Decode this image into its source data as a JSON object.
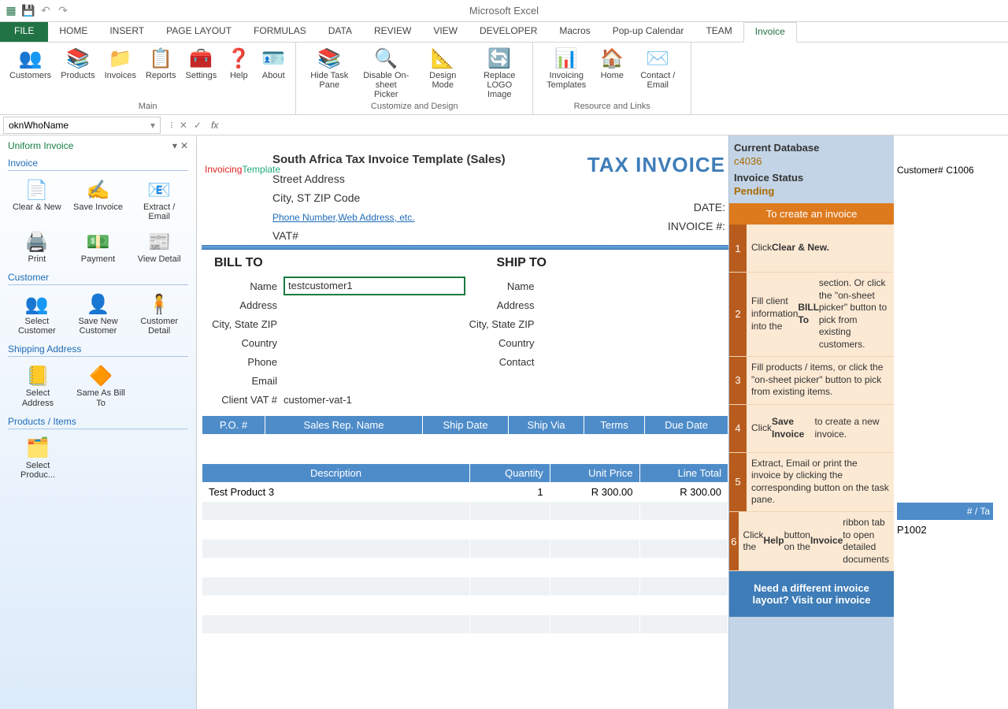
{
  "app_title": "Microsoft Excel",
  "tabs": [
    "FILE",
    "HOME",
    "INSERT",
    "PAGE LAYOUT",
    "FORMULAS",
    "DATA",
    "REVIEW",
    "VIEW",
    "DEVELOPER",
    "Macros",
    "Pop-up Calendar",
    "TEAM",
    "Invoice"
  ],
  "ribbon": {
    "main": {
      "label": "Main",
      "items": [
        "Customers",
        "Products",
        "Invoices",
        "Reports",
        "Settings",
        "Help",
        "About"
      ]
    },
    "design": {
      "label": "Customize and Design",
      "items": [
        "Hide Task Pane",
        "Disable On-sheet Picker",
        "Design Mode",
        "Replace LOGO Image"
      ]
    },
    "resource": {
      "label": "Resource and Links",
      "items": [
        "Invoicing Templates",
        "Home",
        "Contact / Email"
      ]
    }
  },
  "name_box": "oknWhoName",
  "task_pane": {
    "title": "Uniform Invoice",
    "sections": {
      "invoice": {
        "label": "Invoice",
        "items": [
          "Clear & New",
          "Save Invoice",
          "Extract / Email",
          "Print",
          "Payment",
          "View Detail"
        ]
      },
      "customer": {
        "label": "Customer",
        "items": [
          "Select Customer",
          "Save New Customer",
          "Customer Detail"
        ]
      },
      "shipping": {
        "label": "Shipping Address",
        "items": [
          "Select Address",
          "Same As Bill To"
        ]
      },
      "products": {
        "label": "Products / Items",
        "items": [
          "Select Produc..."
        ]
      }
    }
  },
  "doc": {
    "title": "South Africa Tax Invoice Template (Sales)",
    "street": "Street Address",
    "city": "City, ST  ZIP Code",
    "phone_link": "Phone Number,Web Address, etc.",
    "vat": "VAT#",
    "tax_invoice": "TAX INVOICE",
    "date_lbl": "DATE:",
    "inv_lbl": "INVOICE #:",
    "bill_to": "BILL TO",
    "ship_to": "SHIP TO",
    "fields": [
      "Name",
      "Address",
      "City, State ZIP",
      "Country",
      "Phone",
      "Email",
      "Client VAT #"
    ],
    "ship_fields": [
      "Name",
      "Address",
      "City, State ZIP",
      "Country",
      "Contact"
    ],
    "bill_name": "testcustomer1",
    "client_vat": "customer-vat-1",
    "order_headers": [
      "P.O. #",
      "Sales Rep. Name",
      "Ship Date",
      "Ship Via",
      "Terms",
      "Due Date"
    ],
    "line_headers": [
      "Description",
      "Quantity",
      "Unit Price",
      "Line Total"
    ],
    "lines": [
      {
        "desc": "Test Product 3",
        "qty": "1",
        "price": "R 300.00",
        "total": "R 300.00"
      }
    ]
  },
  "side": {
    "db_lbl": "Current Database",
    "db_id": "c4036",
    "status_lbl": "Invoice Status",
    "status": "Pending",
    "banner": "To create an invoice",
    "steps": [
      "Click <b>Clear & New.</b>",
      "Fill client information into the <b>BILL To</b> section. Or click the \"on-sheet picker\" button to pick from existing customers.",
      "Fill products / items, or click the \"on-sheet picker\" button to pick from existing items.",
      "Click <b>Save Invoice</b> to create a new invoice.",
      "Extract, Email or print the invoice by clicking the corresponding button on the task pane.",
      "Click the <b>Help</b> button on the <b>Invoice</b> ribbon tab to open detailed documents"
    ],
    "cta": "Need a different invoice layout? Visit our invoice"
  },
  "far_right": {
    "cust_lbl": "Customer#",
    "cust_id": "C1006",
    "col_h": "# / Ta",
    "code": "P1002"
  }
}
